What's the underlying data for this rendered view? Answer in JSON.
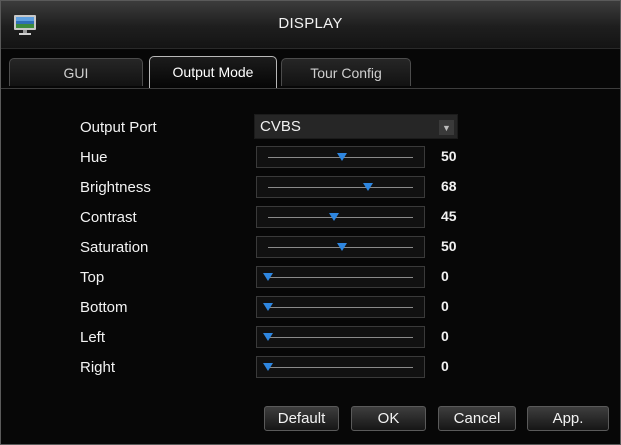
{
  "window": {
    "title": "DISPLAY",
    "icon": "monitor-icon"
  },
  "tabs": [
    {
      "label": "GUI",
      "active": false
    },
    {
      "label": "Output Mode",
      "active": true
    },
    {
      "label": "Tour Config",
      "active": false
    }
  ],
  "output_port": {
    "label": "Output Port",
    "value": "CVBS",
    "icon": "dropdown-arrow-icon"
  },
  "sliders": [
    {
      "label": "Hue",
      "value": "50",
      "position": 50
    },
    {
      "label": "Brightness",
      "value": "68",
      "position": 68
    },
    {
      "label": "Contrast",
      "value": "45",
      "position": 45
    },
    {
      "label": "Saturation",
      "value": "50",
      "position": 50
    },
    {
      "label": "Top",
      "value": "0",
      "position": 0
    },
    {
      "label": "Bottom",
      "value": "0",
      "position": 0
    },
    {
      "label": "Left",
      "value": "0",
      "position": 0
    },
    {
      "label": "Right",
      "value": "0",
      "position": 0
    }
  ],
  "buttons": {
    "default": "Default",
    "ok": "OK",
    "cancel": "Cancel",
    "apply": "App."
  },
  "colors": {
    "accent": "#2e86e0",
    "background": "#070707"
  }
}
